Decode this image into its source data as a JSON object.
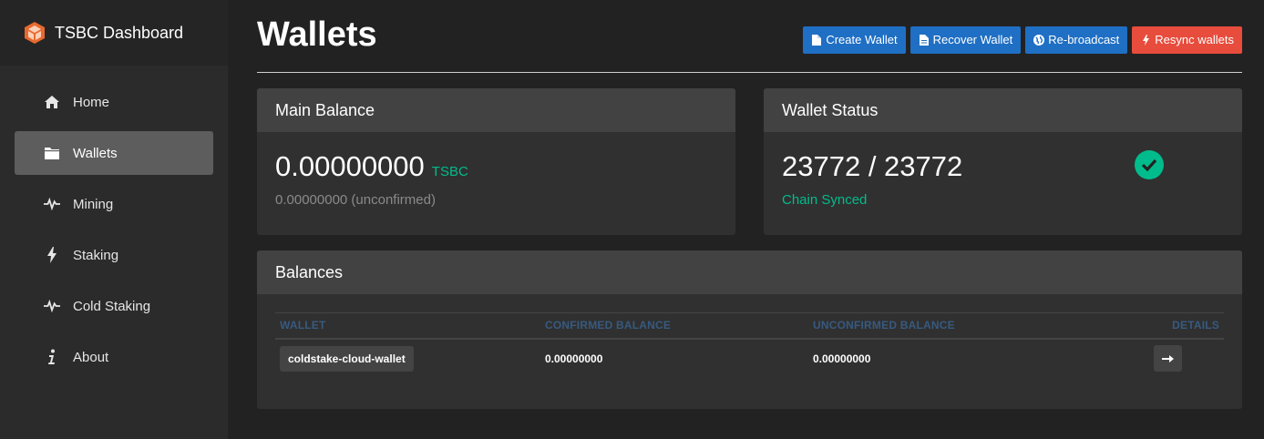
{
  "sidebar": {
    "brand": {
      "title": "TSBC Dashboard",
      "logo_icon": "cube-logo-icon",
      "logo_color": "#e8692f"
    },
    "items": [
      {
        "label": "Home",
        "icon": "home-icon",
        "active": false
      },
      {
        "label": "Wallets",
        "icon": "folder-icon",
        "active": true
      },
      {
        "label": "Mining",
        "icon": "pulse-icon",
        "active": false
      },
      {
        "label": "Staking",
        "icon": "bolt-icon",
        "active": false
      },
      {
        "label": "Cold Staking",
        "icon": "pulse-icon",
        "active": false
      },
      {
        "label": "About",
        "icon": "info-icon",
        "active": false
      }
    ]
  },
  "header": {
    "title": "Wallets",
    "buttons": [
      {
        "label": "Create Wallet",
        "icon": "file-icon",
        "color": "#1f6fc4"
      },
      {
        "label": "Recover Wallet",
        "icon": "file-text-icon",
        "color": "#1f6fc4"
      },
      {
        "label": "Re-broadcast",
        "icon": "globe-icon",
        "color": "#1f6fc4"
      },
      {
        "label": "Resync wallets",
        "icon": "bolt-icon",
        "color": "#e74c3c"
      }
    ]
  },
  "main_balance": {
    "title": "Main Balance",
    "amount": "0.00000000",
    "unit": "TSBC",
    "unconfirmed": "0.00000000 (unconfirmed)"
  },
  "wallet_status": {
    "title": "Wallet Status",
    "progress": "23772 / 23772",
    "status": "Chain Synced",
    "status_icon": "check-circle-icon",
    "accent": "#00bc8c"
  },
  "balances": {
    "title": "Balances",
    "columns": [
      "WALLET",
      "CONFIRMED BALANCE",
      "UNCONFIRMED BALANCE",
      "DETAILS"
    ],
    "rows": [
      {
        "wallet": "coldstake-cloud-wallet",
        "confirmed": "0.00000000",
        "unconfirmed": "0.00000000",
        "details_icon": "arrow-right-icon"
      }
    ]
  }
}
